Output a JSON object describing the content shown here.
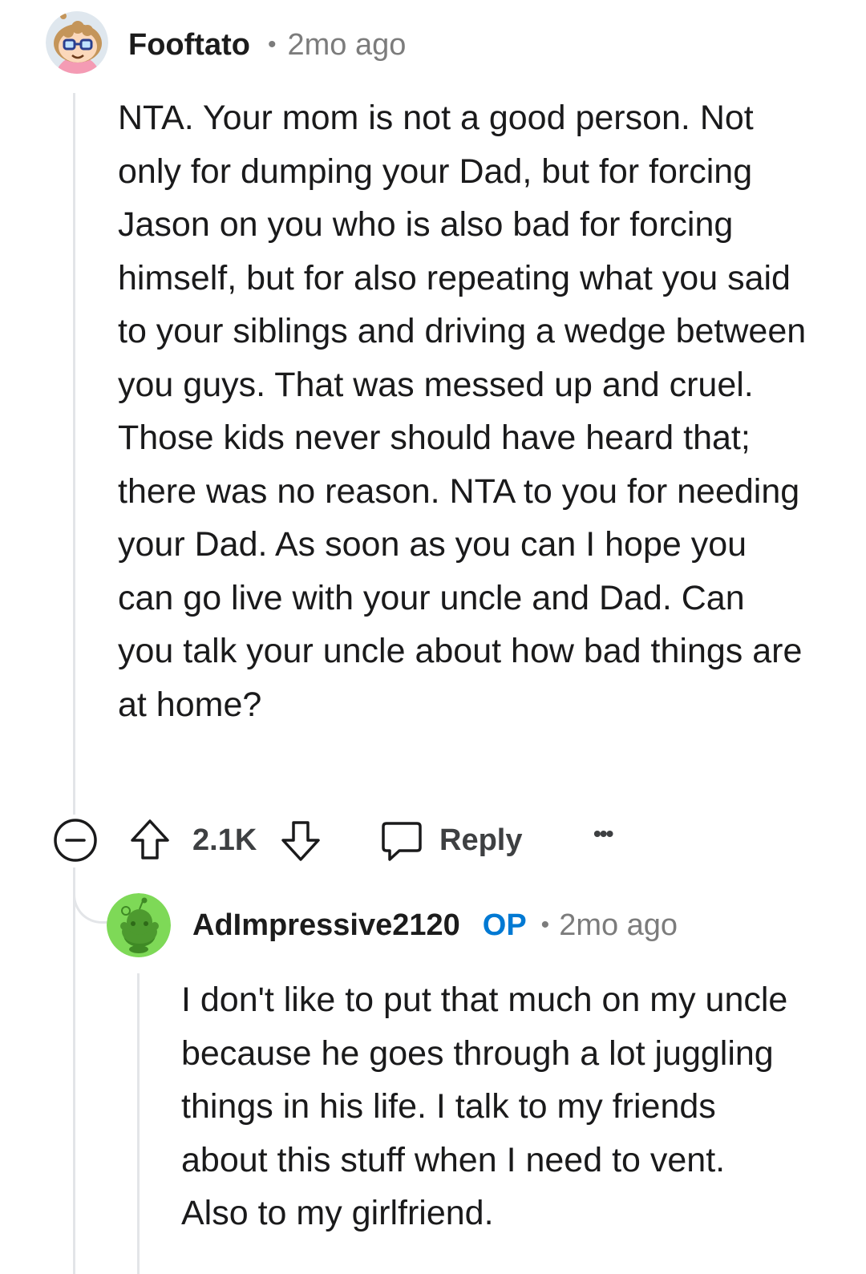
{
  "comment": {
    "username": "Fooftato",
    "separator": "•",
    "time": "2mo ago",
    "avatar_icon": "snoo-avatar-glasses-icon",
    "body": [
      "NTA. Your mom is not a good person. Not only for dumping your Dad, but for forcing Jason on you who is also bad for forcing himself, but for also repeating what you said to your siblings and driving a wedge between you guys. That was messed up and cruel. Those kids never should have heard that; there was no reason. NTA to you for needing your Dad. As soon as you can I hope you can go live with your uncle and Dad. Can you talk your uncle about how bad things are at home?"
    ],
    "actions": {
      "collapse_icon": "collapse-minus-icon",
      "upvote_icon": "upvote-arrow-icon",
      "vote_count": "2.1K",
      "downvote_icon": "downvote-arrow-icon",
      "reply_icon": "speech-bubble-icon",
      "reply_label": "Reply",
      "more_icon": "more-dots-icon",
      "more_label": "•••"
    }
  },
  "reply": {
    "username": "AdImpressive2120",
    "op_badge": "OP",
    "separator": "•",
    "time": "2mo ago",
    "avatar_icon": "snoo-avatar-green-icon",
    "avatar_color": "#7ed957",
    "body": [
      "I don't like to put that much on my uncle because he goes through a lot juggling things in his life. I talk to my friends about this stuff when I need to vent. Also to my girlfriend."
    ]
  },
  "colors": {
    "accent_op": "#0079d3",
    "thread_line": "#e3e5e8",
    "meta_gray": "#7c7c7c"
  }
}
